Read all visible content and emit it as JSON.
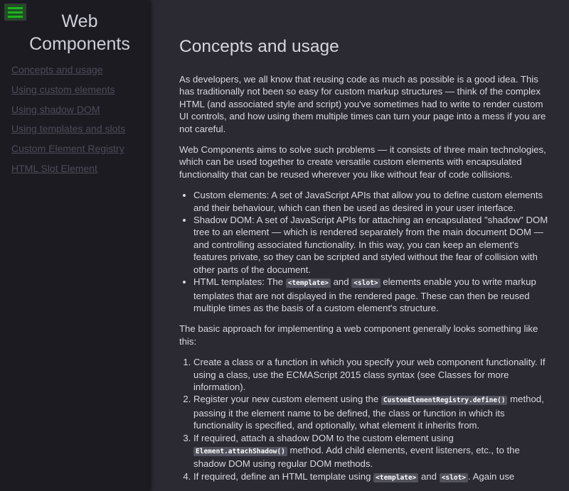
{
  "sidebar": {
    "menu_icon": "hamburger-menu-icon",
    "title_line1": "Web",
    "title_line2": "Components",
    "links": [
      "Concepts and usage",
      "Using custom elements",
      "Using shadow DOM",
      "Using templates and slots",
      "Custom Element Registry",
      "HTML Slot Element"
    ]
  },
  "main": {
    "heading": "Concepts and usage",
    "p1": "As developers, we all know that reusing code as much as possible is a good idea. This has traditionally not been so easy for custom markup structures — think of the complex HTML (and associated style and script) you've sometimes had to write to render custom UI controls, and how using them multiple times can turn your page into a mess if you are not careful.",
    "p2": "Web Components aims to solve such problems — it consists of three main technologies, which can be used together to create versatile custom elements with encapsulated functionality that can be reused wherever you like without fear of code collisions.",
    "bullets": {
      "b1": "Custom elements: A set of JavaScript APIs that allow you to define custom elements and their behaviour, which can then be used as desired in your user interface.",
      "b2": "Shadow DOM: A set of JavaScript APIs for attaching an encapsulated \"shadow\" DOM tree to an element — which is rendered separately from the main document DOM — and controlling associated functionality. In this way, you can keep an element's features private, so they can be scripted and styled without the fear of collision with other parts of the document.",
      "b3_before": "HTML templates: The ",
      "b3_code1": "<template>",
      "b3_mid": " and ",
      "b3_code2": "<slot>",
      "b3_after": " elements enable you to write markup templates that are not displayed in the rendered page. These can then be reused multiple times as the basis of a custom element's structure."
    },
    "p3": "The basic approach for implementing a web component generally looks something like this:",
    "steps": {
      "s1": "Create a class or a function in which you specify your web component functionality. If using a class, use the ECMAScript 2015 class syntax (see Classes for more information).",
      "s2_before": "Register your new custom element using the ",
      "s2_code": "CustomElementRegistry.define()",
      "s2_after": " method, passing it the element name to be defined, the class or function in which its functionality is specified, and optionally, what element it inherits from.",
      "s3_before": "If required, attach a shadow DOM to the custom element using ",
      "s3_code": "Element.attachShadow()",
      "s3_after": " method. Add child elements, event listeners, etc., to the shadow DOM using regular DOM methods.",
      "s4_before": "If required, define an HTML template using ",
      "s4_code1": "<template>",
      "s4_mid": " and ",
      "s4_code2": "<slot>",
      "s4_after": ". Again use"
    }
  }
}
